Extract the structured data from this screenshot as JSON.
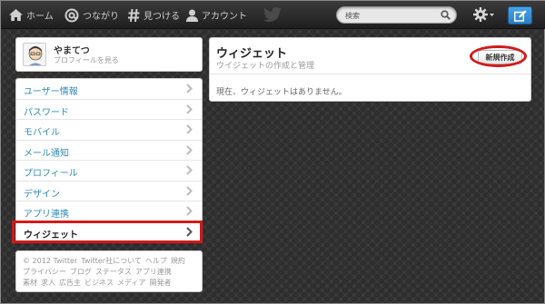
{
  "topbar": {
    "home_label": "ホーム",
    "connect_label": "つながり",
    "discover_label": "見つける",
    "account_label": "アカウント",
    "search_placeholder": "検索"
  },
  "profile": {
    "name": "やまてつ",
    "sub": "プロフィールを見る"
  },
  "menu": {
    "items": [
      {
        "label": "ユーザー情報"
      },
      {
        "label": "パスワード"
      },
      {
        "label": "モバイル"
      },
      {
        "label": "メール通知"
      },
      {
        "label": "プロフィール"
      },
      {
        "label": "デザイン"
      },
      {
        "label": "アプリ連携"
      },
      {
        "label": "ウィジェット",
        "active": true
      }
    ]
  },
  "footer": {
    "links": [
      "© 2012 Twitter",
      "Twitter社について",
      "ヘルプ",
      "規約",
      "プライバシー",
      "ブログ",
      "ステータス",
      "アプリ連携",
      "素材",
      "求人",
      "広告主",
      "ビジネス",
      "メディア",
      "開発者"
    ]
  },
  "widgets": {
    "title": "ウィジェット",
    "subtitle": "ウイジェットの作成と管理",
    "new_button": "新規作成",
    "empty_text": "現在、ウィジェットはありません。"
  },
  "colors": {
    "link": "#2f8bb5",
    "highlight": "#d11a1a",
    "compose": "#2a7fc7"
  }
}
